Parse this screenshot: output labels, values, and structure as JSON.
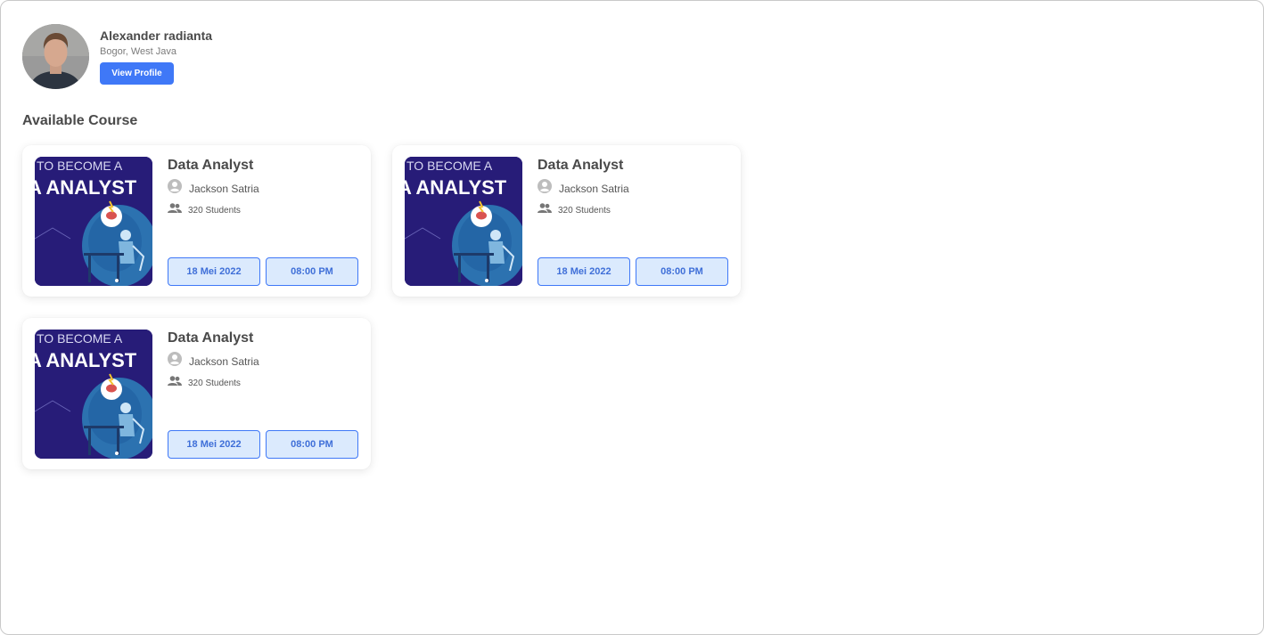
{
  "profile": {
    "name": "Alexander radianta",
    "location": "Bogor, West Java",
    "view_profile_label": "View Profile"
  },
  "section_title": "Available Course",
  "thumbnail_text": {
    "line1": "TO BECOME A",
    "line2": "A ANALYST"
  },
  "courses": [
    {
      "title": "Data Analyst",
      "instructor": "Jackson Satria",
      "students": "320 Students",
      "date": "18 Mei 2022",
      "time": "08:00 PM"
    },
    {
      "title": "Data Analyst",
      "instructor": "Jackson Satria",
      "students": "320 Students",
      "date": "18 Mei 2022",
      "time": "08:00 PM"
    },
    {
      "title": "Data Analyst",
      "instructor": "Jackson Satria",
      "students": "320 Students",
      "date": "18 Mei 2022",
      "time": "08:00 PM"
    }
  ],
  "icons": {
    "instructor": "user-circle-icon",
    "students": "people-icon"
  },
  "colors": {
    "accent": "#3f78f7",
    "pill_bg": "#dbeafd",
    "thumbnail_bg": "#2a1e7e"
  }
}
